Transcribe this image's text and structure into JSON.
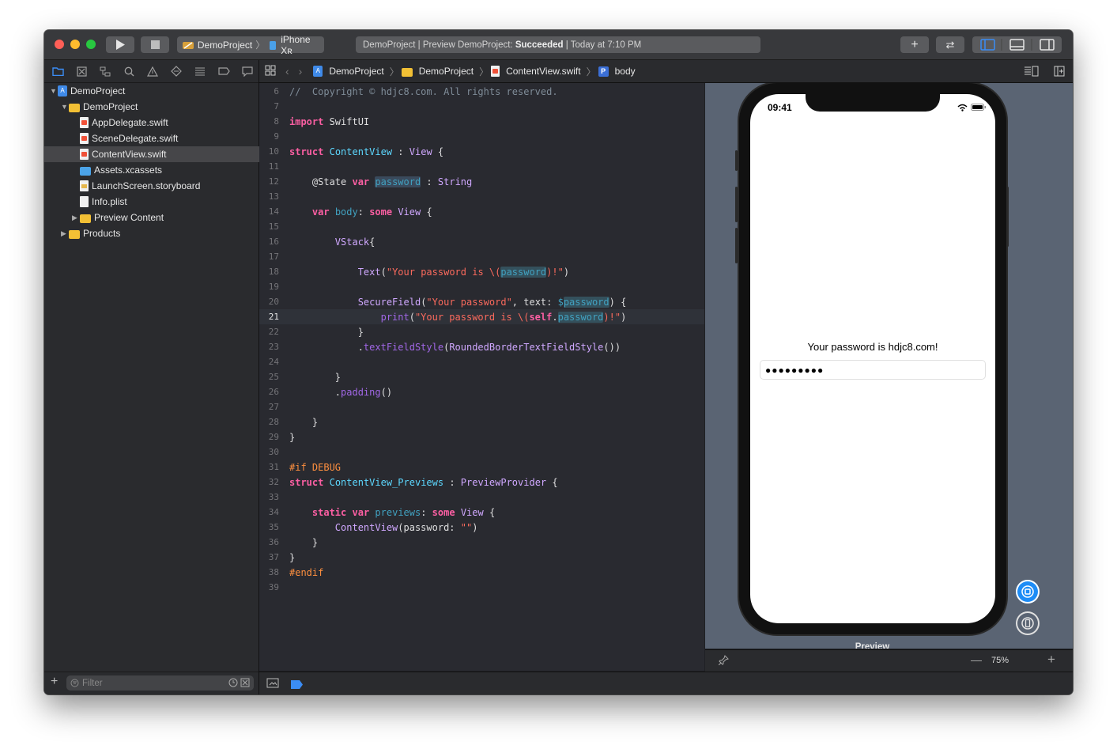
{
  "titlebar": {
    "scheme_project": "DemoProject",
    "scheme_device": "iPhone Xʀ",
    "activity_prefix": "DemoProject | Preview DemoProject:",
    "activity_status": "Succeeded",
    "activity_suffix": "| Today at 7:10 PM"
  },
  "navigator": {
    "items": [
      {
        "label": "DemoProject",
        "type": "project"
      },
      {
        "label": "DemoProject",
        "type": "folder"
      },
      {
        "label": "AppDelegate.swift",
        "type": "swift"
      },
      {
        "label": "SceneDelegate.swift",
        "type": "swift"
      },
      {
        "label": "ContentView.swift",
        "type": "swift"
      },
      {
        "label": "Assets.xcassets",
        "type": "assets"
      },
      {
        "label": "LaunchScreen.storyboard",
        "type": "storyboard"
      },
      {
        "label": "Info.plist",
        "type": "plist"
      },
      {
        "label": "Preview Content",
        "type": "folder"
      },
      {
        "label": "Products",
        "type": "folder"
      }
    ],
    "filter_placeholder": "Filter"
  },
  "jumpbar": {
    "crumbs": [
      "DemoProject",
      "DemoProject",
      "ContentView.swift",
      "body"
    ]
  },
  "editor": {
    "current_line": 21,
    "line_numbers": [
      "6",
      "7",
      "8",
      "9",
      "10",
      "11",
      "12",
      "13",
      "14",
      "15",
      "16",
      "17",
      "18",
      "19",
      "20",
      "21",
      "22",
      "23",
      "24",
      "25",
      "26",
      "27",
      "28",
      "29",
      "30",
      "31",
      "32",
      "33",
      "34",
      "35",
      "36",
      "37",
      "38",
      "39"
    ]
  },
  "preview": {
    "status_time": "09:41",
    "label_text": "Your password is hdjc8.com!",
    "field_value": "●●●●●●●●●",
    "caption": "Preview",
    "zoom": "75%"
  },
  "colors": {
    "accent": "#3b8df5",
    "keyword": "#fc5fa3",
    "type": "#5dd8ff",
    "string": "#fc6a5d"
  }
}
